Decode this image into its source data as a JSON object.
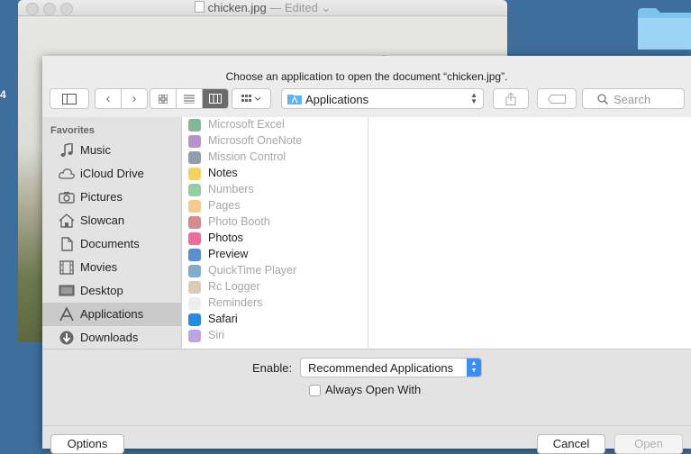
{
  "desktop": {
    "edge_label": "4"
  },
  "background_window": {
    "title": "chicken.jpg",
    "status": "— Edited ⌄"
  },
  "sheet": {
    "prompt": "Choose an application to open the document “chicken.jpg”.",
    "location": "Applications",
    "search_placeholder": "Search"
  },
  "sidebar": {
    "header": "Favorites",
    "items": [
      {
        "label": "Music",
        "icon": "music-icon"
      },
      {
        "label": "iCloud Drive",
        "icon": "cloud-icon"
      },
      {
        "label": "Pictures",
        "icon": "camera-icon"
      },
      {
        "label": "Slowcan",
        "icon": "home-icon"
      },
      {
        "label": "Documents",
        "icon": "document-icon"
      },
      {
        "label": "Movies",
        "icon": "film-icon"
      },
      {
        "label": "Desktop",
        "icon": "desktop-icon"
      },
      {
        "label": "Applications",
        "icon": "applications-icon"
      },
      {
        "label": "Downloads",
        "icon": "download-icon"
      }
    ]
  },
  "apps": [
    {
      "label": "Microsoft Excel",
      "enabled": false,
      "color": "#1f7a44"
    },
    {
      "label": "Microsoft OneNote",
      "enabled": false,
      "color": "#7b3aa0"
    },
    {
      "label": "Mission Control",
      "enabled": false,
      "color": "#3a4a6a"
    },
    {
      "label": "Notes",
      "enabled": true,
      "color": "#f4d35e"
    },
    {
      "label": "Numbers",
      "enabled": false,
      "color": "#3aa55a"
    },
    {
      "label": "Pages",
      "enabled": false,
      "color": "#f0a030"
    },
    {
      "label": "Photo Booth",
      "enabled": false,
      "color": "#b03030"
    },
    {
      "label": "Photos",
      "enabled": true,
      "color": "#e86fa0"
    },
    {
      "label": "Preview",
      "enabled": true,
      "color": "#5a8fd0"
    },
    {
      "label": "QuickTime Player",
      "enabled": false,
      "color": "#1a6aa0"
    },
    {
      "label": "Rc Logger",
      "enabled": false,
      "color": "#c0a080"
    },
    {
      "label": "Reminders",
      "enabled": false,
      "color": "#e0e0e0"
    },
    {
      "label": "Safari",
      "enabled": true,
      "color": "#2a8ae0"
    },
    {
      "label": "Siri",
      "enabled": false,
      "color": "#8a5ad0"
    }
  ],
  "options": {
    "enable_label": "Enable:",
    "enable_value": "Recommended Applications",
    "always_open_label": "Always Open With",
    "always_open_checked": false
  },
  "buttons": {
    "options": "Options",
    "cancel": "Cancel",
    "open": "Open"
  }
}
